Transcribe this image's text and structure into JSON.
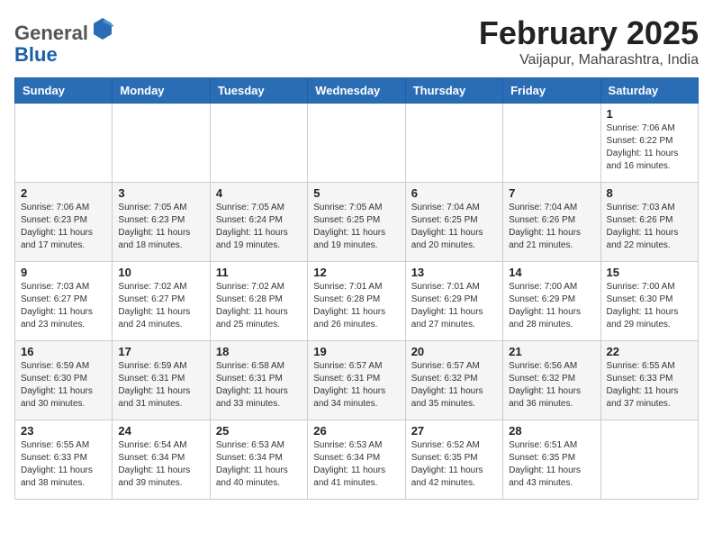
{
  "header": {
    "logo_general": "General",
    "logo_blue": "Blue",
    "month_title": "February 2025",
    "location": "Vaijapur, Maharashtra, India"
  },
  "days_of_week": [
    "Sunday",
    "Monday",
    "Tuesday",
    "Wednesday",
    "Thursday",
    "Friday",
    "Saturday"
  ],
  "weeks": [
    [
      {
        "day": "",
        "info": ""
      },
      {
        "day": "",
        "info": ""
      },
      {
        "day": "",
        "info": ""
      },
      {
        "day": "",
        "info": ""
      },
      {
        "day": "",
        "info": ""
      },
      {
        "day": "",
        "info": ""
      },
      {
        "day": "1",
        "info": "Sunrise: 7:06 AM\nSunset: 6:22 PM\nDaylight: 11 hours\nand 16 minutes."
      }
    ],
    [
      {
        "day": "2",
        "info": "Sunrise: 7:06 AM\nSunset: 6:23 PM\nDaylight: 11 hours\nand 17 minutes."
      },
      {
        "day": "3",
        "info": "Sunrise: 7:05 AM\nSunset: 6:23 PM\nDaylight: 11 hours\nand 18 minutes."
      },
      {
        "day": "4",
        "info": "Sunrise: 7:05 AM\nSunset: 6:24 PM\nDaylight: 11 hours\nand 19 minutes."
      },
      {
        "day": "5",
        "info": "Sunrise: 7:05 AM\nSunset: 6:25 PM\nDaylight: 11 hours\nand 19 minutes."
      },
      {
        "day": "6",
        "info": "Sunrise: 7:04 AM\nSunset: 6:25 PM\nDaylight: 11 hours\nand 20 minutes."
      },
      {
        "day": "7",
        "info": "Sunrise: 7:04 AM\nSunset: 6:26 PM\nDaylight: 11 hours\nand 21 minutes."
      },
      {
        "day": "8",
        "info": "Sunrise: 7:03 AM\nSunset: 6:26 PM\nDaylight: 11 hours\nand 22 minutes."
      }
    ],
    [
      {
        "day": "9",
        "info": "Sunrise: 7:03 AM\nSunset: 6:27 PM\nDaylight: 11 hours\nand 23 minutes."
      },
      {
        "day": "10",
        "info": "Sunrise: 7:02 AM\nSunset: 6:27 PM\nDaylight: 11 hours\nand 24 minutes."
      },
      {
        "day": "11",
        "info": "Sunrise: 7:02 AM\nSunset: 6:28 PM\nDaylight: 11 hours\nand 25 minutes."
      },
      {
        "day": "12",
        "info": "Sunrise: 7:01 AM\nSunset: 6:28 PM\nDaylight: 11 hours\nand 26 minutes."
      },
      {
        "day": "13",
        "info": "Sunrise: 7:01 AM\nSunset: 6:29 PM\nDaylight: 11 hours\nand 27 minutes."
      },
      {
        "day": "14",
        "info": "Sunrise: 7:00 AM\nSunset: 6:29 PM\nDaylight: 11 hours\nand 28 minutes."
      },
      {
        "day": "15",
        "info": "Sunrise: 7:00 AM\nSunset: 6:30 PM\nDaylight: 11 hours\nand 29 minutes."
      }
    ],
    [
      {
        "day": "16",
        "info": "Sunrise: 6:59 AM\nSunset: 6:30 PM\nDaylight: 11 hours\nand 30 minutes."
      },
      {
        "day": "17",
        "info": "Sunrise: 6:59 AM\nSunset: 6:31 PM\nDaylight: 11 hours\nand 31 minutes."
      },
      {
        "day": "18",
        "info": "Sunrise: 6:58 AM\nSunset: 6:31 PM\nDaylight: 11 hours\nand 33 minutes."
      },
      {
        "day": "19",
        "info": "Sunrise: 6:57 AM\nSunset: 6:31 PM\nDaylight: 11 hours\nand 34 minutes."
      },
      {
        "day": "20",
        "info": "Sunrise: 6:57 AM\nSunset: 6:32 PM\nDaylight: 11 hours\nand 35 minutes."
      },
      {
        "day": "21",
        "info": "Sunrise: 6:56 AM\nSunset: 6:32 PM\nDaylight: 11 hours\nand 36 minutes."
      },
      {
        "day": "22",
        "info": "Sunrise: 6:55 AM\nSunset: 6:33 PM\nDaylight: 11 hours\nand 37 minutes."
      }
    ],
    [
      {
        "day": "23",
        "info": "Sunrise: 6:55 AM\nSunset: 6:33 PM\nDaylight: 11 hours\nand 38 minutes."
      },
      {
        "day": "24",
        "info": "Sunrise: 6:54 AM\nSunset: 6:34 PM\nDaylight: 11 hours\nand 39 minutes."
      },
      {
        "day": "25",
        "info": "Sunrise: 6:53 AM\nSunset: 6:34 PM\nDaylight: 11 hours\nand 40 minutes."
      },
      {
        "day": "26",
        "info": "Sunrise: 6:53 AM\nSunset: 6:34 PM\nDaylight: 11 hours\nand 41 minutes."
      },
      {
        "day": "27",
        "info": "Sunrise: 6:52 AM\nSunset: 6:35 PM\nDaylight: 11 hours\nand 42 minutes."
      },
      {
        "day": "28",
        "info": "Sunrise: 6:51 AM\nSunset: 6:35 PM\nDaylight: 11 hours\nand 43 minutes."
      },
      {
        "day": "",
        "info": ""
      }
    ]
  ]
}
